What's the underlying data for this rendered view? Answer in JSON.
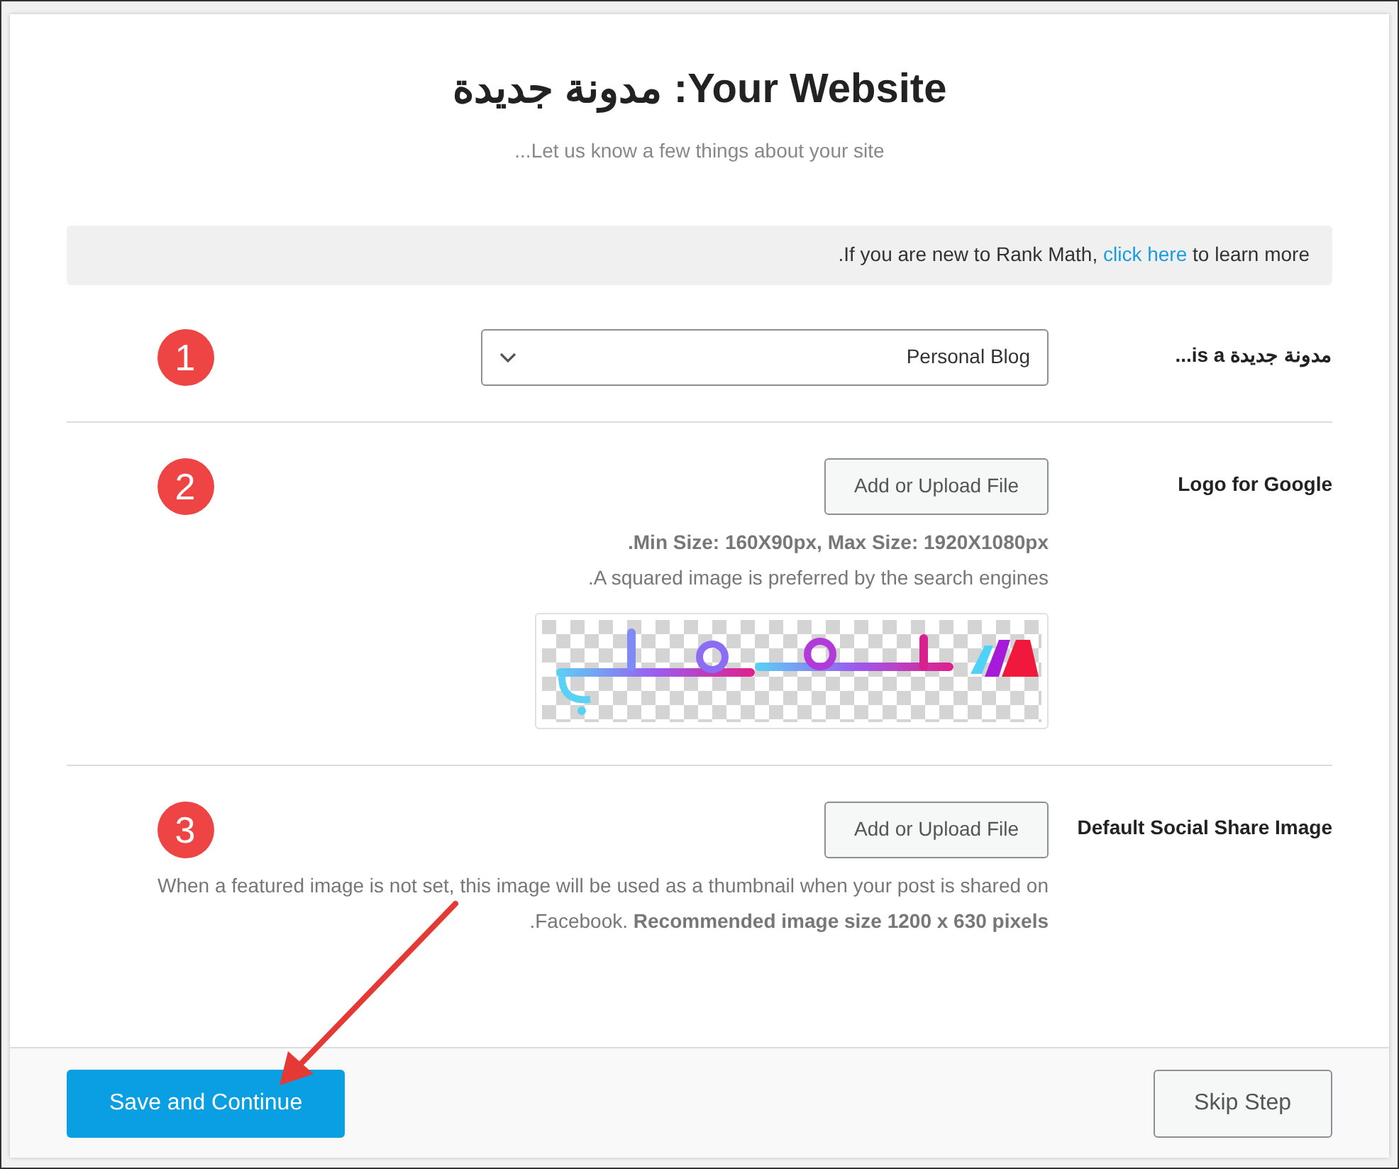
{
  "header": {
    "title": "Your Website: مدونة جديدة",
    "subtitle": "Let us know a few things about your site..."
  },
  "notice": {
    "before": ".If you are new to Rank Math, ",
    "link": "click here",
    "after": " to learn more"
  },
  "sections": [
    {
      "kind": "select",
      "label": "مدونة جديدة is a...",
      "badge": "1",
      "value": "Personal Blog"
    },
    {
      "kind": "upload",
      "label": "Logo for Google",
      "badge": "2",
      "button": "Add or Upload File",
      "notes": [
        "**.Min Size: 160X90px, Max Size: 1920X1080px**",
        ".A squared image is preferred by the search engines"
      ],
      "preview": {
        "kind": "picture"
      }
    },
    {
      "kind": "upload",
      "label": "Default Social Share Image",
      "badge": "3",
      "button": "Add or Upload File",
      "notes": [
        "When a featured image is not set, this image will be used as a thumbnail when your post is shared on",
        ".Facebook. **Recommended image size 1200 x 630 pixels**"
      ]
    }
  ],
  "footer": {
    "primary": "Save and Continue",
    "secondary": "Skip Step"
  }
}
